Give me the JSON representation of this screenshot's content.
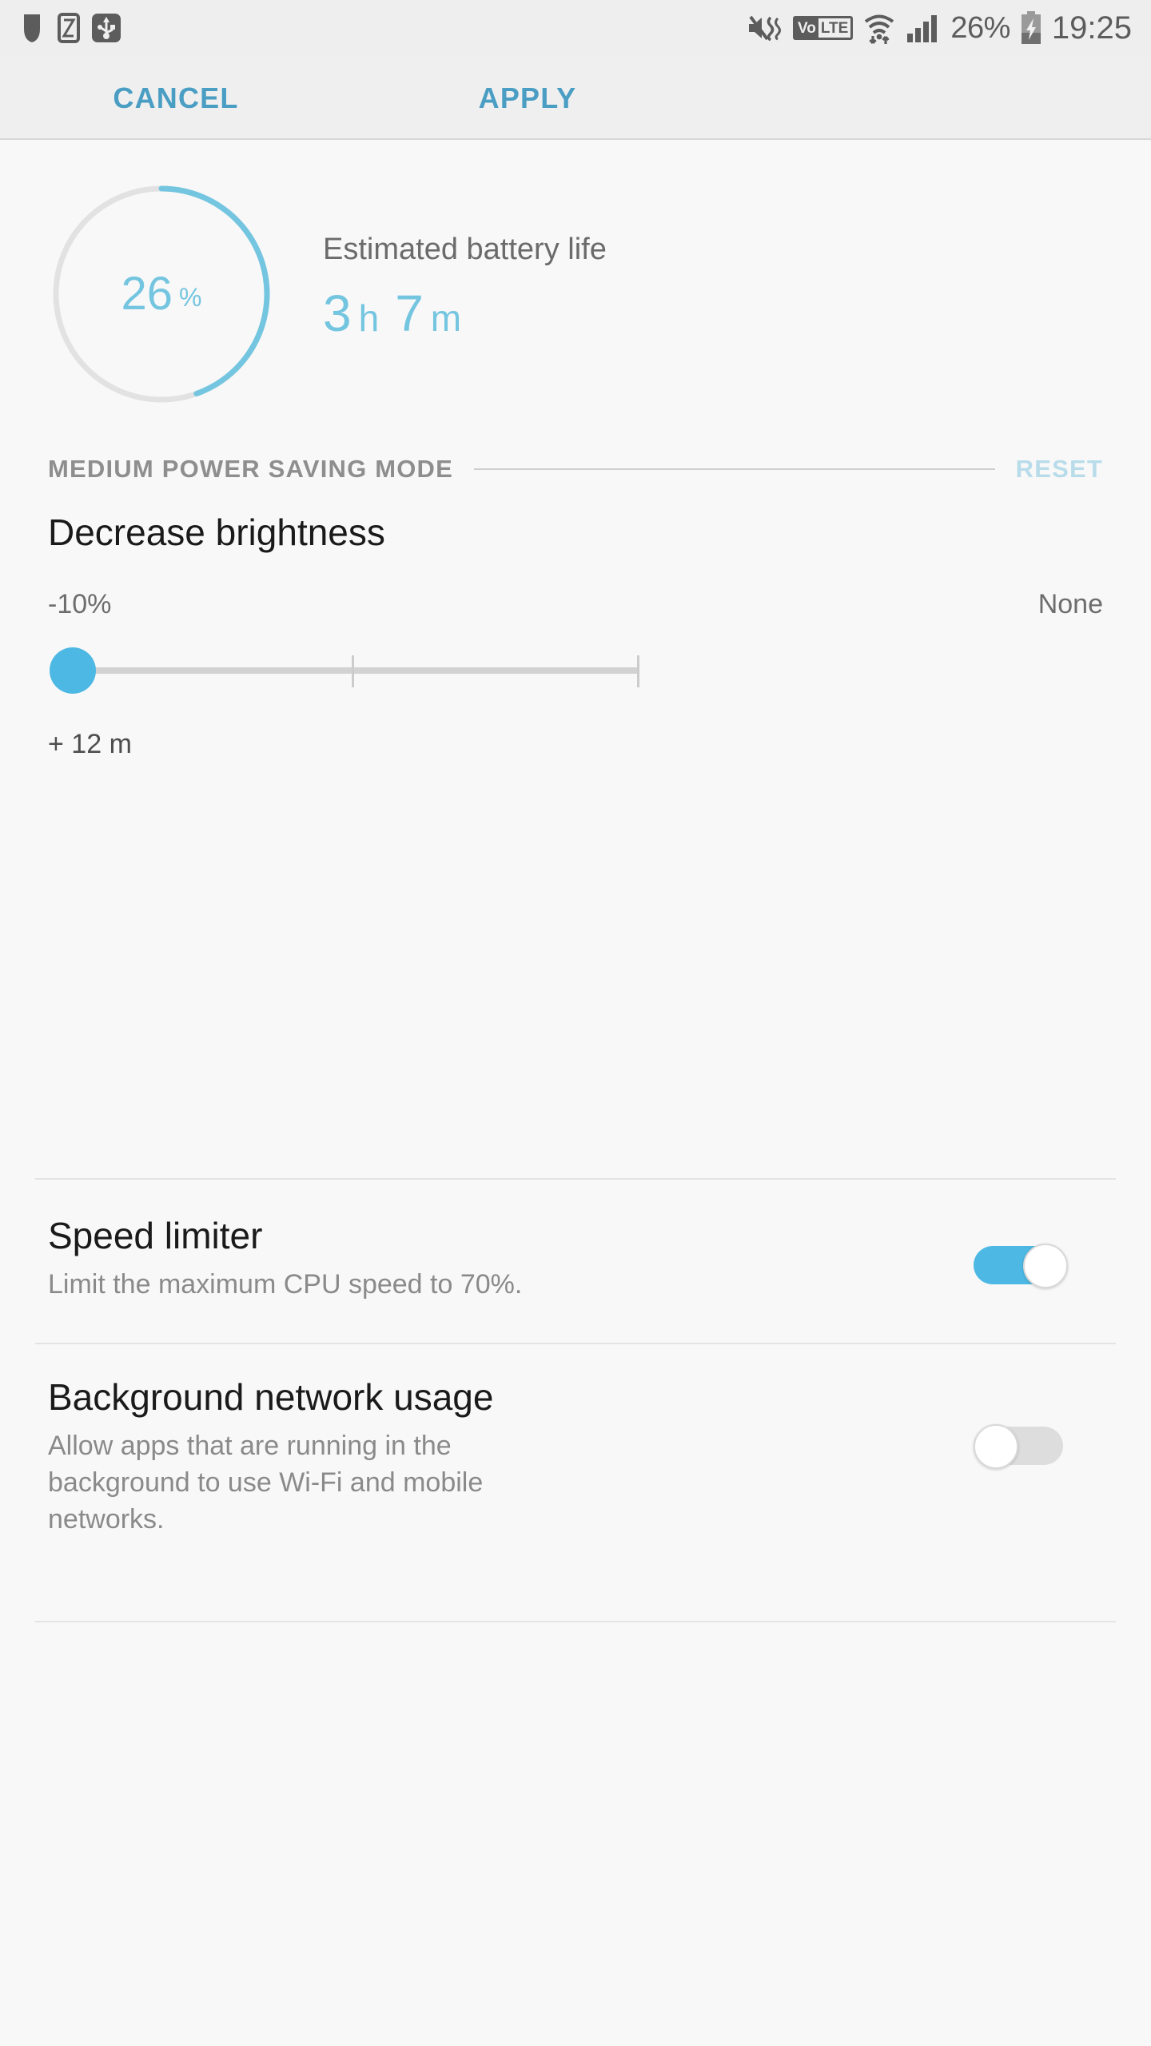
{
  "status_bar": {
    "left_icons": [
      "app-notification-icon",
      "smart-manager-icon",
      "usb-connection-icon"
    ],
    "right_icons": [
      "mute-vibrate-icon",
      "volte-icon",
      "wifi-icon",
      "signal-bars-icon",
      "battery-charging-icon"
    ],
    "volte_prefix": "Vo",
    "volte_suffix": "LTE",
    "battery_percent": "26%",
    "clock": "19:25"
  },
  "action_bar": {
    "cancel_label": "CANCEL",
    "apply_label": "APPLY",
    "accent_color": "#4a9ec4"
  },
  "battery": {
    "percent_value": "26",
    "percent_symbol": "%",
    "percent_numeric": 26,
    "estimated_title": "Estimated battery life",
    "hours_value": "3",
    "hours_unit": "h",
    "minutes_value": "7",
    "minutes_unit": "m",
    "arc_color": "#74c5e0",
    "track_color": "#e2e2e2"
  },
  "section": {
    "title": "MEDIUM POWER SAVING MODE",
    "reset_label": "RESET"
  },
  "brightness": {
    "title": "Decrease brightness",
    "min_label": "-10%",
    "max_label": "None",
    "delta_label": "+ 12 m",
    "thumb_position_percent": 0
  },
  "speed_limiter": {
    "title": "Speed limiter",
    "subtitle": "Limit the maximum CPU speed to 70%.",
    "toggle_state": "on"
  },
  "background_network": {
    "title": "Background network usage",
    "subtitle": "Allow apps that are running in the background to use Wi-Fi and mobile networks.",
    "toggle_state": "off"
  }
}
